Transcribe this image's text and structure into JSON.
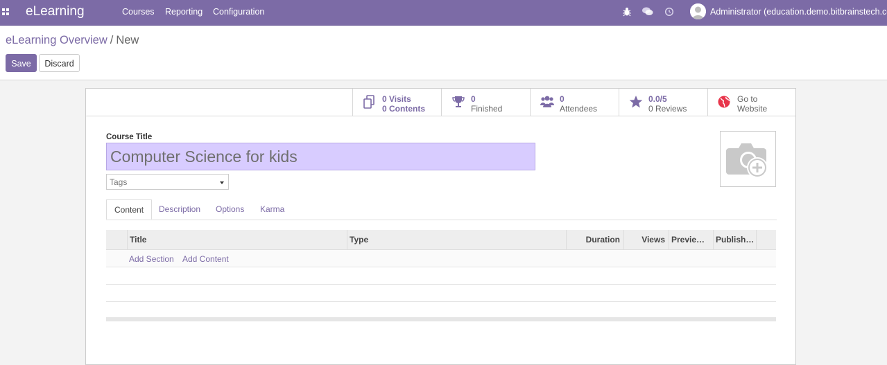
{
  "topbar": {
    "apps_icon": "apps-grid-icon",
    "brand": "eLearning",
    "menu": [
      "Courses",
      "Reporting",
      "Configuration"
    ],
    "icons": [
      "bug-icon",
      "chat-icon",
      "clock-icon"
    ],
    "user": "Administrator (education.demo.bitbrainstech.com)",
    "color": "#7c6ba6"
  },
  "breadcrumb": {
    "parent": "eLearning Overview",
    "separator": "/",
    "current": "New"
  },
  "buttons": {
    "save": "Save",
    "discard": "Discard"
  },
  "stats": [
    {
      "icon": "copy-icon",
      "line1": "0 Visits",
      "line2": "0 Contents"
    },
    {
      "icon": "trophy-icon",
      "line1": "0",
      "line2": "Finished"
    },
    {
      "icon": "users-icon",
      "line1": "0",
      "line2": "Attendees"
    },
    {
      "icon": "star-icon",
      "line1": "0.0/5",
      "line2": "0 Reviews"
    },
    {
      "icon": "globe-icon",
      "line1": "Go to",
      "line2": "Website"
    }
  ],
  "form": {
    "title_label": "Course Title",
    "title_value": "Computer Science for kids",
    "tags_placeholder": "Tags",
    "image_icon": "camera-add-icon"
  },
  "tabs": [
    "Content",
    "Description",
    "Options",
    "Karma"
  ],
  "table": {
    "columns": [
      "Title",
      "Type",
      "Duration",
      "Views",
      "Previe…",
      "Publish…"
    ],
    "add_section": "Add Section",
    "add_content": "Add Content"
  }
}
